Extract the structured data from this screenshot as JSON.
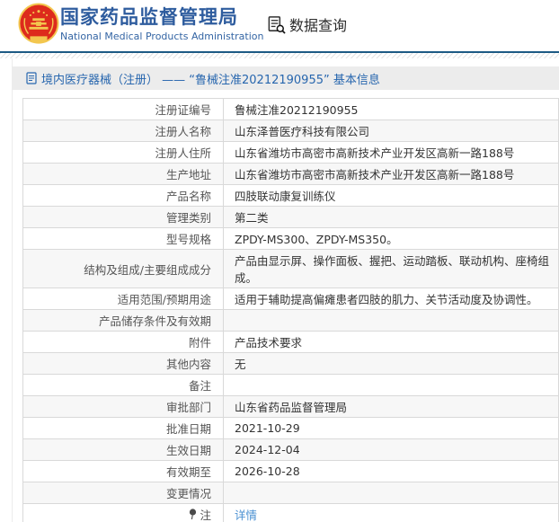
{
  "header": {
    "org_name_cn": "国家药品监督管理局",
    "org_name_en": "National Medical Products Administration",
    "data_query_label": "数据查询"
  },
  "section": {
    "title": "境内医疗器械（注册） —— “鲁械注准20212190955” 基本信息"
  },
  "table": {
    "rows": [
      {
        "label": "注册证编号",
        "value": "鲁械注准20212190955"
      },
      {
        "label": "注册人名称",
        "value": "山东泽普医疗科技有限公司"
      },
      {
        "label": "注册人住所",
        "value": "山东省潍坊市高密市高新技术产业开发区高新一路188号"
      },
      {
        "label": "生产地址",
        "value": "山东省潍坊市高密市高新技术产业开发区高新一路188号"
      },
      {
        "label": "产品名称",
        "value": "四肢联动康复训练仪"
      },
      {
        "label": "管理类别",
        "value": "第二类"
      },
      {
        "label": "型号规格",
        "value": "ZPDY-MS300、ZPDY-MS350。"
      },
      {
        "label": "结构及组成/主要组成成分",
        "value": "产品由显示屏、操作面板、握把、运动踏板、联动机构、座椅组成。"
      },
      {
        "label": "适用范围/预期用途",
        "value": "适用于辅助提高偏瘫患者四肢的肌力、关节活动度及协调性。"
      },
      {
        "label": "产品储存条件及有效期",
        "value": ""
      },
      {
        "label": "附件",
        "value": "产品技术要求"
      },
      {
        "label": "其他内容",
        "value": "无"
      },
      {
        "label": "备注",
        "value": ""
      },
      {
        "label": "审批部门",
        "value": "山东省药品监督管理局"
      },
      {
        "label": "批准日期",
        "value": "2021-10-29"
      },
      {
        "label": "生效日期",
        "value": "2024-12-04"
      },
      {
        "label": "有效期至",
        "value": "2026-10-28"
      },
      {
        "label": "变更情况",
        "value": ""
      },
      {
        "label": "注",
        "value": "详情"
      }
    ],
    "note_link_label": "详情"
  },
  "icons": {
    "emblem": "national-emblem",
    "data_query": "document-search-icon",
    "section_doc": "document-icon",
    "note": "note-balloon-icon"
  },
  "colors": {
    "title_blue": "#2e5c9e",
    "section_blue": "#2766ae",
    "link_blue": "#4a90d2",
    "divider_blue": "#1d5a84",
    "emblem_red": "#dd2b1c",
    "emblem_gold": "#f3c74f",
    "row_alt_bg": "#f7f7f7",
    "table_border": "#d9d9d9"
  }
}
